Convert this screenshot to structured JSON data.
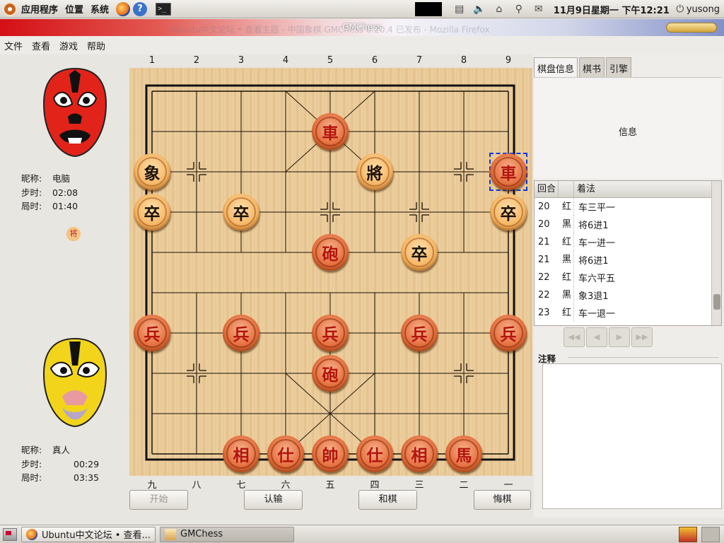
{
  "top_panel": {
    "menus": [
      "应用程序",
      "位置",
      "系统"
    ],
    "help_glyph": "?",
    "terminal_glyph": ">_",
    "clock": "11月9日星期一 下午12:21",
    "user": "yusong",
    "icons": [
      "ubuntu-logo-icon",
      "firefox-icon",
      "help-icon",
      "terminal-icon",
      "network-monitor-icon",
      "clipboard-icon",
      "volume-icon",
      "network-icon",
      "pin-icon",
      "mail-icon",
      "power-icon"
    ]
  },
  "window": {
    "title": "GMChess",
    "ghost_title": "Ubuntu中文论坛 • 查看主题 - 中国象棋 GMChess 0.20.4 已发布 - Mozilla Firefox"
  },
  "menubar": [
    "文件",
    "查看",
    "游戏",
    "帮助"
  ],
  "players": {
    "top": {
      "nick_label": "昵称:",
      "nick": "电脑",
      "step_label": "步时:",
      "step": "02:08",
      "game_label": "局时:",
      "game": "01:40",
      "turn_marker": "将"
    },
    "bottom": {
      "nick_label": "昵称:",
      "nick": "真人",
      "step_label": "步时:",
      "step": "00:29",
      "game_label": "局时:",
      "game": "03:35"
    }
  },
  "board": {
    "col_numbers_top": [
      "1",
      "2",
      "3",
      "4",
      "5",
      "6",
      "7",
      "8",
      "9"
    ],
    "col_numbers_bottom": [
      "九",
      "八",
      "七",
      "六",
      "五",
      "四",
      "三",
      "二",
      "一"
    ],
    "pieces": [
      {
        "name": "red-chariot",
        "char": "車",
        "color": "red",
        "col": 4,
        "row": 1
      },
      {
        "name": "black-elephant",
        "char": "象",
        "color": "black",
        "col": 0,
        "row": 2
      },
      {
        "name": "black-general",
        "char": "將",
        "color": "black",
        "col": 5,
        "row": 2
      },
      {
        "name": "red-chariot",
        "char": "車",
        "color": "red",
        "col": 8,
        "row": 2,
        "selected": true
      },
      {
        "name": "black-soldier",
        "char": "卒",
        "color": "black",
        "col": 0,
        "row": 3
      },
      {
        "name": "black-soldier",
        "char": "卒",
        "color": "black",
        "col": 2,
        "row": 3
      },
      {
        "name": "black-soldier",
        "char": "卒",
        "color": "black",
        "col": 8,
        "row": 3
      },
      {
        "name": "red-cannon",
        "char": "砲",
        "color": "red",
        "col": 4,
        "row": 4
      },
      {
        "name": "black-soldier",
        "char": "卒",
        "color": "black",
        "col": 6,
        "row": 4
      },
      {
        "name": "red-soldier",
        "char": "兵",
        "color": "red",
        "col": 0,
        "row": 6
      },
      {
        "name": "red-soldier",
        "char": "兵",
        "color": "red",
        "col": 2,
        "row": 6
      },
      {
        "name": "red-soldier",
        "char": "兵",
        "color": "red",
        "col": 4,
        "row": 6
      },
      {
        "name": "red-soldier",
        "char": "兵",
        "color": "red",
        "col": 6,
        "row": 6
      },
      {
        "name": "red-soldier",
        "char": "兵",
        "color": "red",
        "col": 8,
        "row": 6
      },
      {
        "name": "red-cannon",
        "char": "砲",
        "color": "red",
        "col": 4,
        "row": 7
      },
      {
        "name": "red-elephant",
        "char": "相",
        "color": "red",
        "col": 2,
        "row": 9
      },
      {
        "name": "red-advisor",
        "char": "仕",
        "color": "red",
        "col": 3,
        "row": 9
      },
      {
        "name": "red-general",
        "char": "帥",
        "color": "red",
        "col": 4,
        "row": 9
      },
      {
        "name": "red-advisor",
        "char": "仕",
        "color": "red",
        "col": 5,
        "row": 9
      },
      {
        "name": "red-elephant",
        "char": "相",
        "color": "red",
        "col": 6,
        "row": 9
      },
      {
        "name": "red-horse",
        "char": "馬",
        "color": "red",
        "col": 7,
        "row": 9
      }
    ],
    "position_marks": [
      [
        1,
        2
      ],
      [
        7,
        2
      ],
      [
        4,
        3
      ],
      [
        6,
        3
      ],
      [
        1,
        7
      ],
      [
        7,
        7
      ]
    ]
  },
  "buttons": {
    "start": "开始",
    "resign": "认输",
    "draw": "和棋",
    "undo": "悔棋"
  },
  "right_panel": {
    "tabs": [
      "棋盘信息",
      "棋书",
      "引擎"
    ],
    "info_text": "信息",
    "moves_header": {
      "round": "回合",
      "side": "",
      "move": "着法"
    },
    "moves": [
      {
        "round": "20",
        "side": "红",
        "move": "车三平一"
      },
      {
        "round": "20",
        "side": "黑",
        "move": "将6进1"
      },
      {
        "round": "21",
        "side": "红",
        "move": "车一进一"
      },
      {
        "round": "21",
        "side": "黑",
        "move": "将6进1"
      },
      {
        "round": "22",
        "side": "红",
        "move": "车六平五"
      },
      {
        "round": "22",
        "side": "黑",
        "move": "象3退1"
      },
      {
        "round": "23",
        "side": "红",
        "move": "车一退一"
      }
    ],
    "nav_buttons": [
      "first-move-icon",
      "prev-move-icon",
      "next-move-icon",
      "last-move-icon"
    ],
    "notes_label": "注释"
  },
  "taskbar": {
    "tasks": [
      {
        "label": "Ubuntu中文论坛 • 查看...",
        "icon": "firefox-icon",
        "active": false
      },
      {
        "label": "GMChess",
        "icon": "gmchess-icon",
        "active": true
      }
    ]
  },
  "colors": {
    "red_piece_text": "#b3140c",
    "black_piece_text": "#1d1208",
    "board_wood": "#e8c993",
    "selection": "#1436d8"
  }
}
